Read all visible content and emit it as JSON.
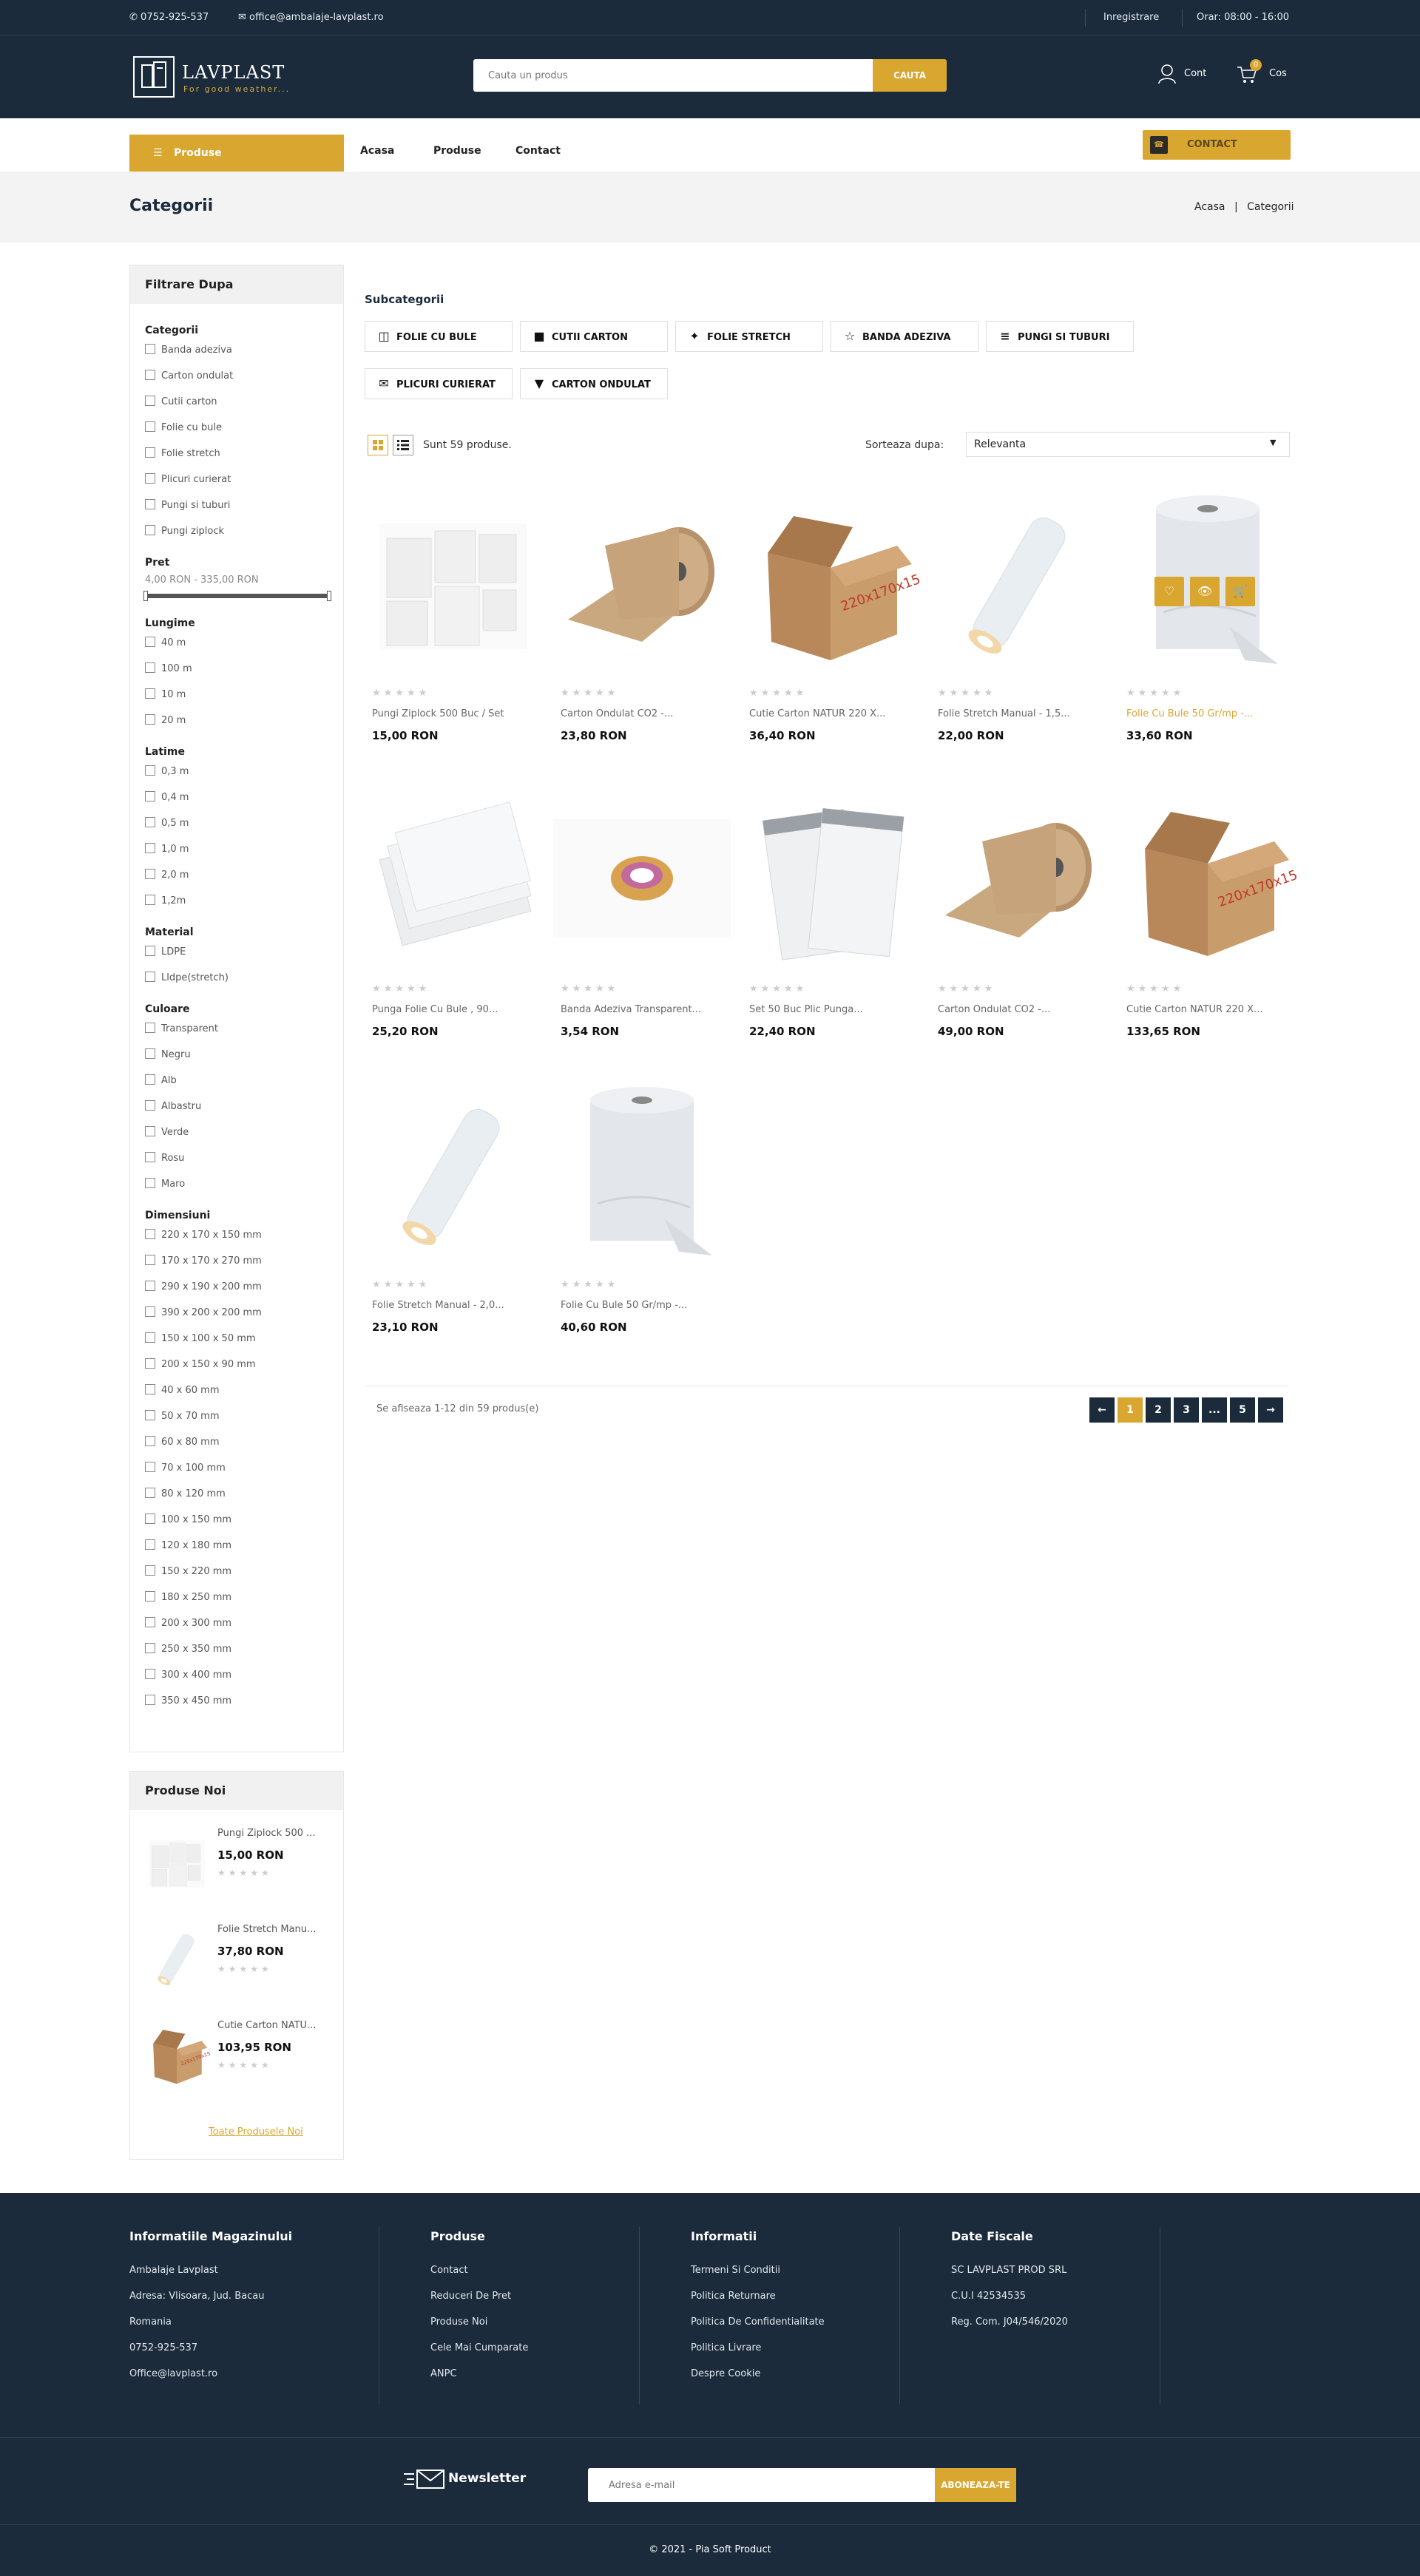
{
  "topbar": {
    "phone": "0752-925-537",
    "email": "office@ambalaje-lavplast.ro",
    "register": "Inregistrare",
    "hours": "Orar: 08:00 - 16:00"
  },
  "header": {
    "logo_name": "LAVPLAST",
    "logo_tagline": "For good weather...",
    "search_placeholder": "Cauta un produs",
    "search_button": "CAUTA",
    "account_label": "Cont",
    "cart_label": "Cos",
    "cart_count": "0"
  },
  "nav": {
    "products_label": "Produse",
    "links": [
      "Acasa",
      "Produse",
      "Contact"
    ],
    "contact_button": "CONTACT"
  },
  "breadcrumb": {
    "title": "Categorii",
    "home": "Acasa",
    "separator": "|",
    "current": "Categorii"
  },
  "filters": {
    "title": "Filtrare Dupa",
    "groups": [
      {
        "name": "Categorii",
        "options": [
          "Banda adeziva",
          "Carton ondulat",
          "Cutii carton",
          "Folie cu bule",
          "Folie stretch",
          "Plicuri curierat",
          "Pungi si tuburi",
          "Pungi ziplock"
        ]
      },
      {
        "name": "Pret",
        "range": "4,00 RON - 335,00 RON"
      },
      {
        "name": "Lungime",
        "options": [
          "40 m",
          "100 m",
          "10 m",
          "20 m"
        ]
      },
      {
        "name": "Latime",
        "options": [
          "0,3 m",
          "0,4 m",
          "0,5 m",
          "1,0 m",
          "2,0 m",
          "1,2m"
        ]
      },
      {
        "name": "Material",
        "options": [
          "LDPE",
          "Lldpe(stretch)"
        ]
      },
      {
        "name": "Culoare",
        "options": [
          "Transparent",
          "Negru",
          "Alb",
          "Albastru",
          "Verde",
          "Rosu",
          "Maro"
        ]
      },
      {
        "name": "Dimensiuni",
        "options": [
          "220 x 170 x 150 mm",
          "170 x 170 x 270 mm",
          "290 x 190 x 200 mm",
          "390 x 200 x 200 mm",
          "150 x 100 x 50 mm",
          "200 x 150 x 90 mm",
          "40 x 60 mm",
          "50 x 70 mm",
          "60 x 80 mm",
          "70 x 100 mm",
          "80 x 120 mm",
          "100 x 150 mm",
          "120 x 180 mm",
          "150 x 220 mm",
          "180 x 250 mm",
          "200 x 300 mm",
          "250 x 350 mm",
          "300 x 400 mm",
          "350 x 450 mm"
        ]
      }
    ]
  },
  "new_products": {
    "title": "Produse Noi",
    "items": [
      {
        "name": "Pungi Ziplock 500 ...",
        "price": "15,00 RON"
      },
      {
        "name": "Folie Stretch Manu...",
        "price": "37,80 RON"
      },
      {
        "name": "Cutie Carton NATU...",
        "price": "103,95 RON"
      }
    ],
    "all_link": "Toate Produsele Noi"
  },
  "content": {
    "subcategories_title": "Subcategorii",
    "subcategories": [
      "FOLIE CU BULE",
      "CUTII CARTON",
      "FOLIE STRETCH",
      "BANDA ADEZIVA",
      "PUNGI SI TUBURI",
      "PLICURI CURIERAT",
      "CARTON ONDULAT"
    ],
    "count_text": "Sunt 59 produse.",
    "sort_label": "Sorteaza dupa:",
    "sort_value": "Relevanta",
    "products": [
      {
        "name": "Pungi Ziplock 500 Buc / Set",
        "price": "15,00 RON",
        "img": "ziplock"
      },
      {
        "name": "Carton Ondulat CO2 -...",
        "price": "23,80 RON",
        "img": "roll"
      },
      {
        "name": "Cutie Carton NATUR 220 X...",
        "price": "36,40 RON",
        "img": "box"
      },
      {
        "name": "Folie Stretch Manual - 1,5...",
        "price": "22,00 RON",
        "img": "stretch"
      },
      {
        "name": "Folie Cu Bule 50 Gr/mp -...",
        "price": "33,60 RON",
        "img": "bubble"
      },
      {
        "name": "Punga Folie Cu Bule , 90...",
        "price": "25,20 RON",
        "img": "bubblebag"
      },
      {
        "name": "Banda Adeziva Transparent...",
        "price": "3,54 RON",
        "img": "tape"
      },
      {
        "name": "Set 50 Buc Plic Punga...",
        "price": "22,40 RON",
        "img": "mailer"
      },
      {
        "name": "Carton Ondulat CO2 -...",
        "price": "49,00 RON",
        "img": "roll"
      },
      {
        "name": "Cutie Carton NATUR 220 X...",
        "price": "133,65 RON",
        "img": "box"
      },
      {
        "name": "Folie Stretch Manual - 2,0...",
        "price": "23,10 RON",
        "img": "stretch"
      },
      {
        "name": "Folie Cu Bule 50 Gr/mp -...",
        "price": "40,60 RON",
        "img": "bubble"
      }
    ],
    "showing_text": "Se afiseaza 1-12 din 59 produs(e)",
    "pagination": [
      "←",
      "1",
      "2",
      "3",
      "...",
      "5",
      "→"
    ]
  },
  "footer": {
    "col1": {
      "title": "Informatiile Magazinului",
      "lines": [
        "Ambalaje Lavplast",
        "Adresa: Vlisoara, Jud. Bacau",
        "Romania",
        "0752-925-537",
        "Office@lavplast.ro"
      ]
    },
    "col2": {
      "title": "Produse",
      "lines": [
        "Contact",
        "Reduceri De Pret",
        "Produse Noi",
        "Cele Mai Cumparate",
        "ANPC"
      ]
    },
    "col3": {
      "title": "Informatii",
      "lines": [
        "Termeni Si Conditii",
        "Politica Returnare",
        "Politica De Confidentialitate",
        "Politica Livrare",
        "Despre Cookie"
      ]
    },
    "col4": {
      "title": "Date Fiscale",
      "lines": [
        "SC LAVPLAST PROD SRL",
        "C.U.I 42534535",
        "Reg. Com. J04/546/2020"
      ]
    },
    "newsletter_label": "Newsletter",
    "newsletter_placeholder": "Adresa e-mail",
    "newsletter_button": "ABONEAZA-TE",
    "copyright": "© 2021 - Pia Soft Product"
  },
  "colors": {
    "navy": "#1b2b3b",
    "gold": "#d9a62f"
  }
}
